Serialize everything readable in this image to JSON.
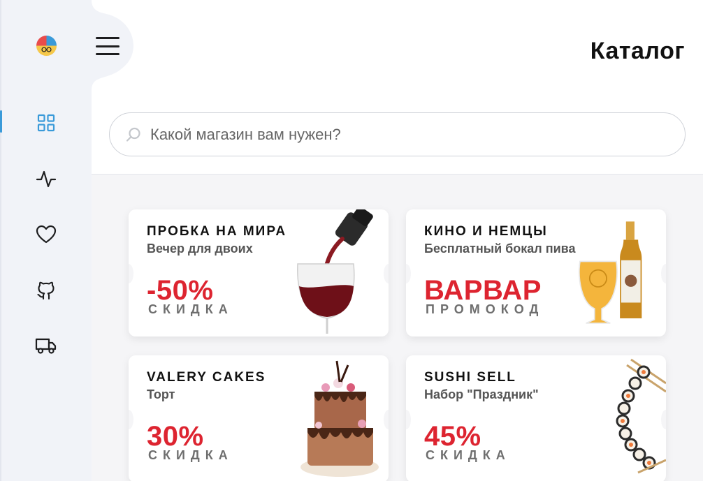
{
  "header": {
    "title": "Каталог"
  },
  "search": {
    "placeholder": "Какой магазин вам нужен?"
  },
  "sidebar": {
    "items": [
      {
        "icon": "grid-icon",
        "active": true
      },
      {
        "icon": "activity-icon",
        "active": false
      },
      {
        "icon": "heart-icon",
        "active": false
      },
      {
        "icon": "github-icon",
        "active": false
      },
      {
        "icon": "truck-icon",
        "active": false
      }
    ],
    "accent": "#3a9ad9"
  },
  "cards": [
    {
      "name": "ПРОБКА НА МИРА",
      "subtitle": "Вечер для двоих",
      "value": "-50%",
      "caption": "СКИДКА",
      "image": "wine-glass"
    },
    {
      "name": "КИНО И НЕМЦЫ",
      "subtitle": "Бесплатный бокал пива",
      "value": "ВАРВАР",
      "caption": "ПРОМОКОД",
      "image": "beer-bottle"
    },
    {
      "name": "VALERY CAKES",
      "subtitle": "Торт",
      "value": "30%",
      "caption": "СКИДКА",
      "image": "cake"
    },
    {
      "name": "SUSHI SELL",
      "subtitle": "Набор \"Праздник\"",
      "value": "45%",
      "caption": "СКИДКА",
      "image": "sushi-rolls"
    }
  ],
  "colors": {
    "accent_red": "#dd2430",
    "sidebar_bg": "#f1f3f8",
    "page_bg": "#f5f5f7"
  }
}
